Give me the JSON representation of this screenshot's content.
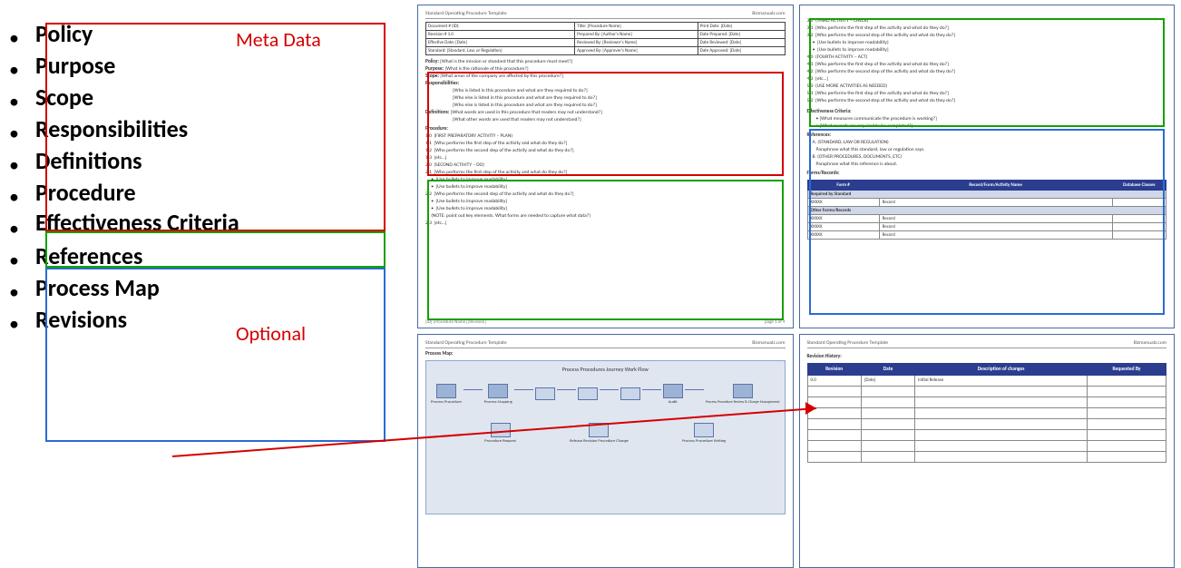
{
  "labels": {
    "meta": "Meta Data",
    "optional": "Optional"
  },
  "outline": [
    "Policy",
    "Purpose",
    "Scope",
    "Responsibilities",
    "Definitions",
    "Procedure",
    "Effectiveness Criteria",
    "References",
    "Process Map",
    "Revisions"
  ],
  "page1": {
    "header_left": "Standard Operating Procedure Template",
    "header_right": "Bizmanualz.com",
    "meta_rows": [
      [
        "Document # (ID):",
        "Title: [Procedure Name]",
        "Print Date: [Date]"
      ],
      [
        "Revision # 1.0",
        "Prepared By: [Author's Name]",
        "Date Prepared: [Date]"
      ],
      [
        "Effective Date: [Date]",
        "Reviewed By: [Reviewer's Name]",
        "Date Reviewed: [Date]"
      ],
      [
        "Standard: [Standard, Law, or Regulation]",
        "Approved By: [Approver's Name]",
        "Date Approved: [Date]"
      ]
    ],
    "red_rows": [
      [
        "Policy:",
        "[What is the mission or standard that this procedure must meet?]"
      ],
      [
        "Purpose:",
        "[What is the rationale of this procedure?]"
      ],
      [
        "Scope:",
        "[What areas of the company are affected by this procedure?]"
      ],
      [
        "Responsibilities:",
        "[Who is listed in this procedure and what are they required to do?]"
      ],
      [
        "",
        "[Who else is listed in this procedure and what are they required to do?]"
      ],
      [
        "",
        "[Who else is listed in this procedure and what are they required to do?]"
      ],
      [
        "Definitions:",
        "[What words are used in this procedure that readers may not understand?]"
      ],
      [
        "",
        "[What other words are used that readers may not understand?]"
      ]
    ],
    "procedure_heading": "Procedure:",
    "procedure_lines": [
      "1.0  (FIRST PREPARATORY ACTIVITY – PLAN)",
      "1.1  [Who performs the first step of the activity and what do they do?]",
      "1.2  [Who performs the second step of the activity and what do they do?]",
      "1.3  [etc…]",
      "2.0  (SECOND ACTIVITY – DO)",
      "2.1  [Who performs the first step of the activity and what do they do?]",
      "     •  [Use bullets to improve readability]",
      "     •  [Use bullets to improve readability]",
      "2.2  [Who performs the second step of the activity and what do they do?]",
      "     •  [Use bullets to improve readability]",
      "     •  [Use bullets to improve readability]",
      "     (NOTE: point out key elements. What forms are needed to capture what data?)",
      "2.3  [etc…]"
    ],
    "footer_left": "[ID] [Procedure Name] [Revision]",
    "footer_right": "page 1 of 4"
  },
  "page2": {
    "green_lines": [
      "3.0  (THIRD ACTIVITY – CHECK)",
      "3.1  [Who performs the first step of the activity and what do they do?]",
      "3.2  [Who performs the second step of the activity and what do they do?]",
      "     •  [Use bullets to improve readability]",
      "     •  [Use bullets to improve readability]",
      "4.0  (FOURTH ACTIVITY – ACT)",
      "4.1  [Who performs the first step of the activity and what do they do?]",
      "4.2  [Who performs the second step of the activity and what do they do?]",
      "4.3  [etc…]",
      "5.0  (USE MORE ACTIVITIES AS NEEDED)",
      "5.1  [Who performs the first step of the activity and what do they do?]",
      "5.2  [Who performs the second step of the activity and what do they do?]"
    ],
    "eff_heading": "Effectiveness Criteria:",
    "eff_bullets": [
      "[What measures communicate the procedure is working?]",
      "[What records are required to be completed?]"
    ],
    "ref_heading": "References:",
    "ref_lines": [
      "A. (STANDARD, LAW OR REGULATION)",
      "Paraphrase what this standard, law or regulation says.",
      "B. (OTHER PROCEDURES, DOCUMENTS, ETC)",
      "Paraphrase what this reference is about."
    ],
    "forms_heading": "Forms/Records:",
    "forms_cols": [
      "Form #",
      "Record/Form/Activity Name",
      "Database Classes"
    ],
    "forms_band1": "Required by Standard",
    "forms_row1": [
      "XXXXX",
      "Record",
      ""
    ],
    "forms_band2": "Other Forms/Records",
    "forms_rows": [
      [
        "XXXXX",
        "Record",
        ""
      ],
      [
        "XXXXX",
        "Record",
        ""
      ],
      [
        "XXXXX",
        "Record",
        ""
      ]
    ]
  },
  "page3": {
    "header_left": "Standard Operating Procedure Template",
    "header_right": "Bizmanualz.com",
    "section": "Process Map:",
    "card_title": "Process Procedures Journey Work Flow",
    "nodes": [
      "Process Procedure",
      "Process Mapping",
      "",
      "",
      "",
      "Audit",
      "Process Procedure Review & Change Management"
    ],
    "bottoms": [
      "Procedure Request",
      "Release Revision Procedure Change",
      "Process Procedure Writing"
    ]
  },
  "page4": {
    "header_left": "Standard Operating Procedure Template",
    "header_right": "Bizmanualz.com",
    "section": "Revision History:",
    "cols": [
      "Revision",
      "Date",
      "Description of changes",
      "Requested By"
    ],
    "row1": [
      "0.0",
      "[Date]",
      "Initial Release",
      ""
    ]
  }
}
